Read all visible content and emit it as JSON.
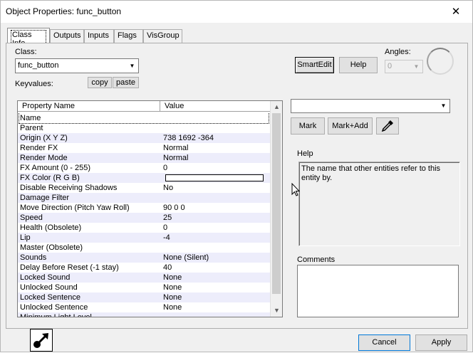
{
  "window": {
    "title": "Object Properties: func_button",
    "close_glyph": "✕"
  },
  "tabs": [
    {
      "label": "Class Info",
      "active": true
    },
    {
      "label": "Outputs"
    },
    {
      "label": "Inputs"
    },
    {
      "label": "Flags"
    },
    {
      "label": "VisGroup"
    }
  ],
  "class_info": {
    "class_label": "Class:",
    "class_value": "func_button",
    "keyvalues_label": "Keyvalues:",
    "copy_label": "copy",
    "paste_label": "paste",
    "smartedit_label": "SmartEdit",
    "help_button_label": "Help",
    "angles_label": "Angles:",
    "angles_value": "0"
  },
  "grid": {
    "columns": [
      "Property Name",
      "Value"
    ],
    "rows": [
      {
        "name": "Name",
        "value": ""
      },
      {
        "name": "Parent",
        "value": ""
      },
      {
        "name": "Origin (X Y Z)",
        "value": "738 1692 -364"
      },
      {
        "name": "Render FX",
        "value": "Normal"
      },
      {
        "name": "Render Mode",
        "value": "Normal"
      },
      {
        "name": "FX Amount (0 - 255)",
        "value": "0"
      },
      {
        "name": "FX Color (R G B)",
        "value": ""
      },
      {
        "name": "Disable Receiving Shadows",
        "value": "No"
      },
      {
        "name": "Damage Filter",
        "value": ""
      },
      {
        "name": "Move Direction (Pitch Yaw Roll)",
        "value": "90 0 0"
      },
      {
        "name": "Speed",
        "value": "25"
      },
      {
        "name": "Health (Obsolete)",
        "value": "0"
      },
      {
        "name": "Lip",
        "value": "-4"
      },
      {
        "name": "Master (Obsolete)",
        "value": ""
      },
      {
        "name": "Sounds",
        "value": "None (Silent)"
      },
      {
        "name": "Delay Before Reset (-1 stay)",
        "value": "40"
      },
      {
        "name": "Locked Sound",
        "value": "None"
      },
      {
        "name": "Unlocked Sound",
        "value": "None"
      },
      {
        "name": "Locked Sentence",
        "value": "None"
      },
      {
        "name": "Unlocked Sentence",
        "value": "None"
      },
      {
        "name": "Minimum Light Level",
        "value": ""
      }
    ]
  },
  "right_panel": {
    "value_dropdown": "",
    "mark_label": "Mark",
    "mark_add_label": "Mark+Add",
    "help_label": "Help",
    "help_text": "The name that other entities refer to this entity by.",
    "comments_label": "Comments",
    "comments_value": ""
  },
  "footer": {
    "cancel_label": "Cancel",
    "apply_label": "Apply"
  }
}
